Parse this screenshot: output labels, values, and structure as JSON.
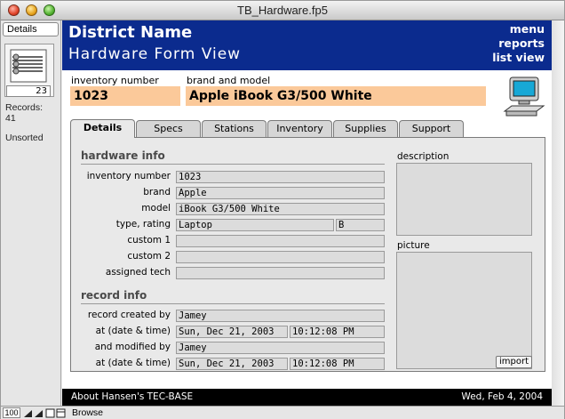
{
  "window": {
    "title": "TB_Hardware.fp5"
  },
  "status": {
    "layout": "Details",
    "record_number": "23",
    "records_label": "Records:",
    "records_count": "41",
    "sort_state": "Unsorted"
  },
  "header": {
    "district": "District Name",
    "form_title": "Hardware Form View",
    "menu": "menu",
    "reports": "reports",
    "list_view": "list view"
  },
  "top_fields": {
    "inv_label": "inventory number",
    "inv_value": "1023",
    "brand_label": "brand and model",
    "brand_value": "Apple iBook G3/500 White"
  },
  "tabs": [
    "Details",
    "Specs",
    "Stations",
    "Inventory",
    "Supplies",
    "Support"
  ],
  "hardware_info": {
    "title": "hardware info",
    "rows": [
      {
        "label": "inventory number",
        "value": "1023"
      },
      {
        "label": "brand",
        "value": "Apple"
      },
      {
        "label": "model",
        "value": "iBook G3/500 White"
      },
      {
        "label": "type, rating",
        "value": "Laptop",
        "value2": "B"
      },
      {
        "label": "custom 1",
        "value": ""
      },
      {
        "label": "custom 2",
        "value": ""
      },
      {
        "label": "assigned tech",
        "value": ""
      }
    ]
  },
  "record_info": {
    "title": "record info",
    "created_by_label": "record created by",
    "created_by": "Jamey",
    "created_at_label": "at (date & time)",
    "created_date": "Sun, Dec 21, 2003",
    "created_time": "10:12:08 PM",
    "modified_by_label": "and modified by",
    "modified_by": "Jamey",
    "modified_at_label": "at (date & time)",
    "modified_date": "Sun, Dec 21, 2003",
    "modified_time": "10:12:08 PM"
  },
  "side": {
    "description_label": "description",
    "picture_label": "picture",
    "import_label": "import"
  },
  "footer": {
    "left": "About Hansen's TEC-BASE",
    "right": "Wed, Feb 4, 2004"
  },
  "bottom": {
    "zoom": "100",
    "mode": "Browse"
  }
}
